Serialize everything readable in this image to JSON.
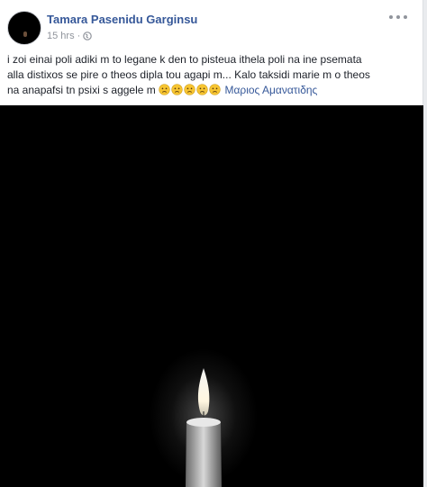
{
  "post": {
    "author": "Tamara Pasenidu Garginsu",
    "timestamp": "15 hrs",
    "separator": "·",
    "privacy_icon": "globe-icon",
    "text_line_1": "i zoi einai poli adiki m to legane k den to pisteua ithela poli na ine psemata",
    "text_line_2": "alla distixos se pire o theos dipla tou agapi m... Kalo taksidi marie m o theos",
    "text_line_3": "na anapafsi tn psixi s aggele m",
    "emoji_icon": "sad-face-emoji",
    "emoji_count": 5,
    "mention": "Μαριος Αμανατιδης",
    "photo_description_icon": "candle-icon"
  },
  "colors": {
    "link": "#365899",
    "text": "#1d2129",
    "meta": "#90949c",
    "emoji": "#f7c532",
    "photo_bg": "#000000"
  }
}
